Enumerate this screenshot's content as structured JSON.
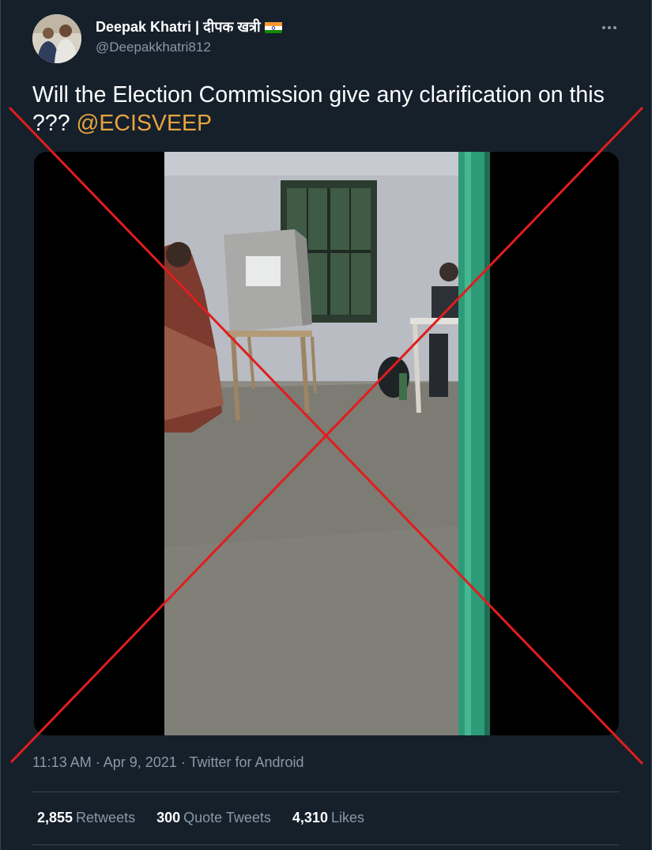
{
  "author": {
    "display_name": "Deepak Khatri | दीपक खत्री",
    "handle": "@Deepakkhatri812"
  },
  "tweet": {
    "text": "Will the Election Commission give any clarification on this ??? ",
    "mention": "@ECISVEEP"
  },
  "meta": {
    "time": "11:13 AM",
    "sep1": " · ",
    "date": "Apr 9, 2021",
    "sep2": " · ",
    "source": "Twitter for Android"
  },
  "stats": [
    {
      "count": "2,855",
      "label": "Retweets"
    },
    {
      "count": "300",
      "label": "Quote Tweets"
    },
    {
      "count": "4,310",
      "label": "Likes"
    }
  ],
  "icons": {
    "more": "more-horizontal-icon",
    "flag": "india-flag-icon"
  },
  "colors": {
    "background": "#15202b",
    "text": "#ffffff",
    "secondary_text": "#8899a6",
    "mention": "#e9a33f",
    "overlay_cross": "#e11d1d",
    "divider": "#38444d"
  }
}
